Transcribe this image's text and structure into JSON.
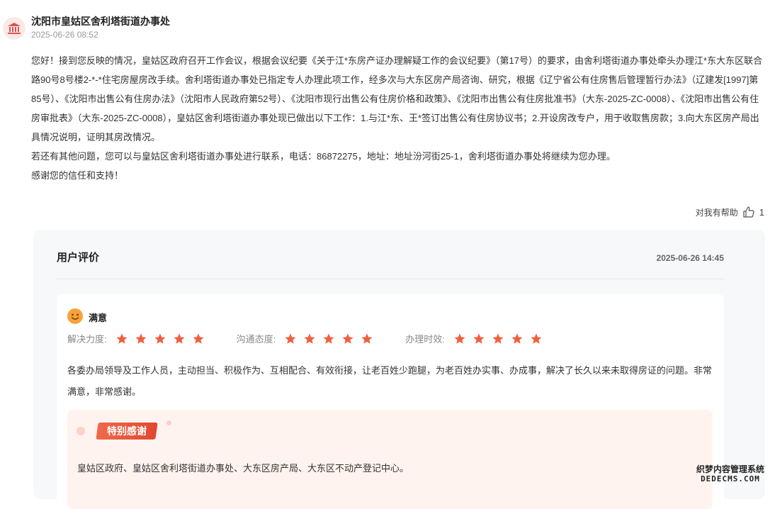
{
  "reply": {
    "org_name": "沈阳市皇姑区舍利塔街道办事处",
    "time": "2025-06-26 08:52",
    "paragraphs": [
      "您好！接到您反映的情况，皇姑区政府召开工作会议，根据会议纪要《关于江*东房产证办理解疑工作的会议纪要》（第17号）的要求，由舍利塔街道办事处牵头办理江*东大东区联合路90号8号楼2-*-*住宅房屋房改手续。舍利塔街道办事处已指定专人办理此项工作，经多次与大东区房产局咨询、研究，根据《辽宁省公有住房售后管理暂行办法》（辽建发[1997]第85号）、《沈阳市出售公有住房办法》（沈阳市人民政府第52号）、《沈阳市现行出售公有住房价格和政策》、《沈阳市出售公有住房批准书》（大东-2025-ZC-0008）、《沈阳市出售公有住房审批表》（大东-2025-ZC-0008），皇姑区舍利塔街道办事处现已做出以下工作：1.与江*东、王*签订出售公有住房协议书；2.开设房改专户，用于收取售房款；3.向大东区房产局出具情况说明，证明其房改情况。",
      "若还有其他问题，您可以与皇姑区舍利塔街道办事处进行联系，电话：86872275，地址：地址汾河街25-1，舍利塔街道办事处将继续为您办理。",
      "感谢您的信任和支持！"
    ],
    "helpful_label": "对我有帮助",
    "helpful_count": "1",
    "icons": {
      "avatar": "government-building-icon",
      "helpful": "thumbs-up-icon"
    }
  },
  "evaluation": {
    "title": "用户评价",
    "date": "2025-06-26 14:45",
    "satisfaction": "满意",
    "ratings": [
      {
        "label": "解决力度:",
        "stars": 5
      },
      {
        "label": "沟通态度:",
        "stars": 5
      },
      {
        "label": "办理时效:",
        "stars": 5
      }
    ],
    "comment": "各委办局领导及工作人员，主动担当、积极作为、互相配合、有效衔接，让老百姓少跑腿，为老百姓办实事、办成事，解决了长久以来未取得房证的问题。非常满意，非常感谢。",
    "special_thanks_label": "特别感谢",
    "special_thanks_text": "皇姑区政府、皇姑区舍利塔街道办事处、大东区房产局、大东区不动产登记中心。",
    "colors": {
      "star": "#f0603f",
      "badge": "#e8533a",
      "face": "#f7a23b"
    }
  },
  "watermark": {
    "line1": "织梦内容管理系统",
    "line2": "DEDECMS.COM"
  }
}
